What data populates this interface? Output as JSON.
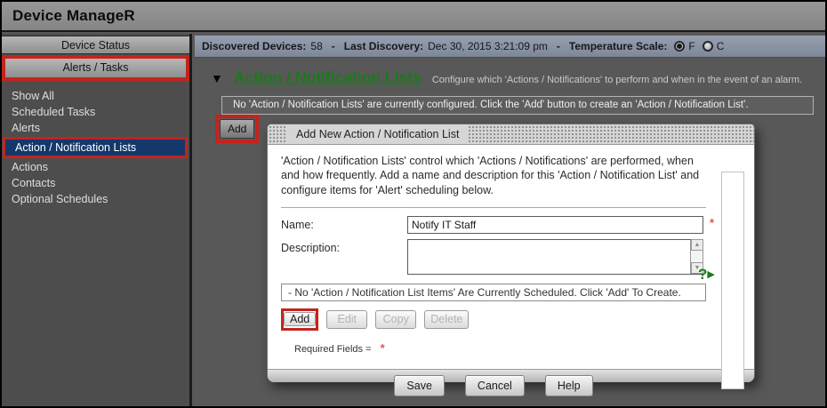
{
  "app": {
    "title": "Device ManageR"
  },
  "colors": {
    "annotation_red": "#c4231d",
    "selected_item_navy": "#14386a",
    "heading_green": "#1b7a1b",
    "status_bar_blue_gray": "#8a93a4"
  },
  "sidebar": {
    "sections": [
      {
        "label": "Device Status",
        "highlighted": false
      },
      {
        "label": "Alerts / Tasks",
        "highlighted": true
      }
    ],
    "items": [
      {
        "label": "Show All"
      },
      {
        "label": "Scheduled Tasks"
      },
      {
        "label": "Alerts"
      },
      {
        "label": "Action / Notification Lists",
        "selected": true,
        "highlighted": true
      },
      {
        "label": "Actions"
      },
      {
        "label": "Contacts"
      },
      {
        "label": "Optional Schedules"
      }
    ]
  },
  "statusbar": {
    "discovered_label": "Discovered Devices:",
    "discovered_value": "58",
    "separator1": "-",
    "last_discovery_label": "Last Discovery:",
    "last_discovery_value": "Dec 30, 2015  3:21:09 pm",
    "separator2": "-",
    "temperature_label": "Temperature Scale:",
    "temp_options": [
      {
        "label": "F",
        "selected": true
      },
      {
        "label": "C",
        "selected": false
      }
    ]
  },
  "main": {
    "collapse_icon": "▼",
    "title": "Action / Notification Lists",
    "subtitle": "Configure which 'Actions / Notifications' to perform and when in the event of an alarm.",
    "empty_message": "No 'Action / Notification Lists' are currently configured. Click the 'Add' button to create an 'Action / Notification List'.",
    "add_button_label": "Add"
  },
  "dialog": {
    "title": "Add New Action / Notification List",
    "description": "'Action / Notification Lists' control which 'Actions / Notifications' are performed, when and how frequently. Add a name and description for this 'Action / Notification List' and configure items for 'Alert' scheduling below.",
    "name_label": "Name:",
    "name_value": "Notify IT Staff",
    "required_marker": "*",
    "description_label": "Description:",
    "description_value": "",
    "items_empty_message": "- No 'Action / Notification List Items' Are Currently Scheduled. Click 'Add' To Create.",
    "buttons": {
      "add": "Add",
      "edit": "Edit",
      "copy": "Copy",
      "delete": "Delete"
    },
    "required_fields_label": "Required Fields =",
    "footer_buttons": {
      "save": "Save",
      "cancel": "Cancel",
      "help": "Help"
    },
    "help_icon": "?",
    "help_arrow": "▶",
    "scroll_up_glyph": "▲",
    "scroll_down_glyph": "▼"
  }
}
